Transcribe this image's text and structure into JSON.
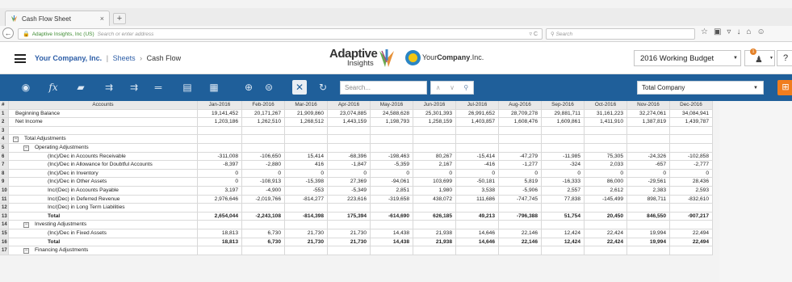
{
  "browser": {
    "tab_title": "Cash Flow Sheet",
    "tab_close": "×",
    "new_tab": "+",
    "url_site": "Adaptive Insights, Inc (US)",
    "url_placeholder": "Search or enter address",
    "search_placeholder": "Search",
    "toolbar_icons": [
      "star-icon",
      "clipboard-icon",
      "pocket-icon",
      "download-icon",
      "home-icon",
      "menu-icon"
    ]
  },
  "header": {
    "company": "Your Company, Inc.",
    "sheets": "Sheets",
    "current": "Cash Flow",
    "logo_word1": "Adaptive",
    "logo_word2": "Insights",
    "your_company": "Your",
    "your_company_bold": "Company",
    "your_company_suffix": ".Inc.",
    "version": "2016 Working Budget",
    "notification_count": "1",
    "help": "?"
  },
  "toolbar": {
    "search_placeholder": "Search...",
    "level": "Total Company",
    "accent": "#1f5f9a",
    "add_color": "#f07d1e"
  },
  "grid": {
    "corner": "#",
    "accounts_header": "Accounts",
    "months": [
      "Jan-2016",
      "Feb-2016",
      "Mar-2016",
      "Apr-2016",
      "May-2016",
      "Jun-2016",
      "Jul-2016",
      "Aug-2016",
      "Sep-2016",
      "Oct-2016",
      "Nov-2016",
      "Dec-2016"
    ],
    "rows": [
      {
        "n": "1",
        "label": "Beginning Balance",
        "indent": 0,
        "collapse": false,
        "bold": false,
        "values": [
          "19,141,452",
          "20,171,267",
          "21,909,860",
          "23,074,885",
          "24,588,628",
          "25,301,393",
          "26,991,652",
          "28,709,278",
          "29,881,711",
          "31,161,223",
          "32,274,061",
          "34,084,941"
        ]
      },
      {
        "n": "2",
        "label": "Net Income",
        "indent": 0,
        "collapse": false,
        "bold": false,
        "values": [
          "1,203,186",
          "1,262,510",
          "1,268,512",
          "1,443,159",
          "1,198,793",
          "1,258,159",
          "1,403,857",
          "1,608,476",
          "1,609,861",
          "1,411,910",
          "1,387,819",
          "1,439,787"
        ]
      },
      {
        "n": "3",
        "label": "",
        "indent": 0,
        "collapse": false,
        "bold": false,
        "values": [
          "",
          "",
          "",
          "",
          "",
          "",
          "",
          "",
          "",
          "",
          "",
          ""
        ]
      },
      {
        "n": "4",
        "label": "Total Adjustments",
        "indent": 1,
        "collapse": true,
        "bold": false,
        "values": [
          "",
          "",
          "",
          "",
          "",
          "",
          "",
          "",
          "",
          "",
          "",
          ""
        ]
      },
      {
        "n": "5",
        "label": "Operating Adjustments",
        "indent": 2,
        "collapse": true,
        "bold": false,
        "values": [
          "",
          "",
          "",
          "",
          "",
          "",
          "",
          "",
          "",
          "",
          "",
          ""
        ]
      },
      {
        "n": "6",
        "label": "(Inc)/Dec in Accounts Receivable",
        "indent": 3,
        "collapse": false,
        "bold": false,
        "values": [
          "-311,008",
          "-106,650",
          "15,414",
          "-68,396",
          "-198,463",
          "80,267",
          "-15,414",
          "-47,279",
          "-11,985",
          "75,305",
          "-24,326",
          "-102,858"
        ]
      },
      {
        "n": "7",
        "label": "(Inc)/Dec in Allowance for Doubtful Accounts",
        "indent": 3,
        "collapse": false,
        "bold": false,
        "values": [
          "-8,397",
          "-2,880",
          "416",
          "-1,847",
          "-5,359",
          "2,167",
          "-416",
          "-1,277",
          "-324",
          "2,033",
          "-657",
          "-2,777"
        ]
      },
      {
        "n": "8",
        "label": "(Inc)/Dec in Inventory",
        "indent": 3,
        "collapse": false,
        "bold": false,
        "values": [
          "0",
          "0",
          "0",
          "0",
          "0",
          "0",
          "0",
          "0",
          "0",
          "0",
          "0",
          "0"
        ]
      },
      {
        "n": "9",
        "label": "(Inc)/Dec in Other Assets",
        "indent": 3,
        "collapse": false,
        "bold": false,
        "values": [
          "0",
          "-108,913",
          "-15,398",
          "27,369",
          "-94,061",
          "103,699",
          "-50,181",
          "5,819",
          "-16,333",
          "86,000",
          "-29,561",
          "28,436"
        ]
      },
      {
        "n": "10",
        "label": "Inc/(Dec) in Accounts Payable",
        "indent": 3,
        "collapse": false,
        "bold": false,
        "values": [
          "3,197",
          "-4,900",
          "-553",
          "-5,349",
          "2,851",
          "1,980",
          "3,538",
          "-5,906",
          "2,557",
          "2,612",
          "2,383",
          "2,593"
        ]
      },
      {
        "n": "11",
        "label": "Inc/(Dec) in Deferred Revenue",
        "indent": 3,
        "collapse": false,
        "bold": false,
        "values": [
          "2,976,646",
          "-2,019,766",
          "-814,277",
          "223,616",
          "-319,658",
          "438,072",
          "111,686",
          "-747,745",
          "77,838",
          "-145,499",
          "898,711",
          "-832,610"
        ]
      },
      {
        "n": "12",
        "label": "Inc/(Dec) in Long Term Liabilities",
        "indent": 3,
        "collapse": false,
        "bold": false,
        "values": [
          "",
          "",
          "",
          "",
          "",
          "",
          "",
          "",
          "",
          "",
          "",
          ""
        ]
      },
      {
        "n": "13",
        "label": "Total",
        "indent": 3,
        "collapse": false,
        "bold": true,
        "values": [
          "2,654,044",
          "-2,243,108",
          "-814,398",
          "175,394",
          "-614,690",
          "626,185",
          "49,213",
          "-796,388",
          "51,754",
          "20,450",
          "846,550",
          "-907,217"
        ]
      },
      {
        "n": "14",
        "label": "Investing Adjustments",
        "indent": 2,
        "collapse": true,
        "bold": false,
        "values": [
          "",
          "",
          "",
          "",
          "",
          "",
          "",
          "",
          "",
          "",
          "",
          ""
        ]
      },
      {
        "n": "15",
        "label": "(Inc)/Dec in Fixed Assets",
        "indent": 3,
        "collapse": false,
        "bold": false,
        "values": [
          "18,813",
          "6,730",
          "21,730",
          "21,730",
          "14,438",
          "21,938",
          "14,646",
          "22,146",
          "12,424",
          "22,424",
          "19,994",
          "22,494"
        ]
      },
      {
        "n": "16",
        "label": "Total",
        "indent": 3,
        "collapse": false,
        "bold": true,
        "values": [
          "18,813",
          "6,730",
          "21,730",
          "21,730",
          "14,438",
          "21,938",
          "14,646",
          "22,146",
          "12,424",
          "22,424",
          "19,994",
          "22,494"
        ]
      },
      {
        "n": "17",
        "label": "Financing Adjustments",
        "indent": 2,
        "collapse": true,
        "bold": false,
        "values": [
          "",
          "",
          "",
          "",
          "",
          "",
          "",
          "",
          "",
          "",
          "",
          ""
        ]
      }
    ]
  }
}
